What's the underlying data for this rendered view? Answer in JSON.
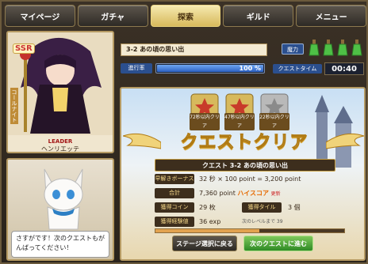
{
  "nav": [
    {
      "label": "マイページ",
      "active": false
    },
    {
      "label": "ガチャ",
      "active": false
    },
    {
      "label": "探索",
      "active": true
    },
    {
      "label": "ギルド",
      "active": false
    },
    {
      "label": "メニュー",
      "active": false
    }
  ],
  "card": {
    "rarity": "SSR",
    "role": "LEADER",
    "name": "ヘンリエッテ",
    "side_label": "コールナイト"
  },
  "companion": {
    "message": "さすがです！次のクエストもがんばってください！"
  },
  "quest_header": {
    "title": "3-2 あの頃の思い出",
    "progress_label": "進行率",
    "progress_value": 100,
    "progress_text": "100 %",
    "mana_label": "魔力",
    "potions_count": 4,
    "time_label": "クエストタイム",
    "time_value": "00:40"
  },
  "result": {
    "medals": [
      {
        "label": "72秒以内クリア",
        "color": "#c83a2a"
      },
      {
        "label": "47秒以内クリア",
        "color": "#c83a2a"
      },
      {
        "label": "22秒以内クリア",
        "color": "#8a8a8a"
      }
    ],
    "banner": "クエストクリア",
    "quest_title": "クエスト 3-2 あの頃の思い出",
    "time_bonus_label": "早解きボーナス",
    "time_bonus_value": "32 秒 × 100 point = 3,200 point",
    "total_label": "合計",
    "total_value": "7,360 point",
    "hiscore_text": "ハイスコア",
    "hiscore_badge": "更新",
    "coin_label": "獲得コイン",
    "coin_value": "29 枚",
    "tile_label": "獲得タイル",
    "tile_value": "3 個",
    "exp_label": "獲得経験値",
    "exp_value": "36 exp",
    "exp_next": "次のレベルまで 39",
    "exp_progress": 0.55,
    "back_button": "ステージ選択に戻る",
    "next_button": "次のクエストに進む"
  },
  "colors": {
    "accent_gold": "#d7b95c",
    "bar_blue": "#2b4f8e",
    "next_green": "#2f8a25"
  }
}
